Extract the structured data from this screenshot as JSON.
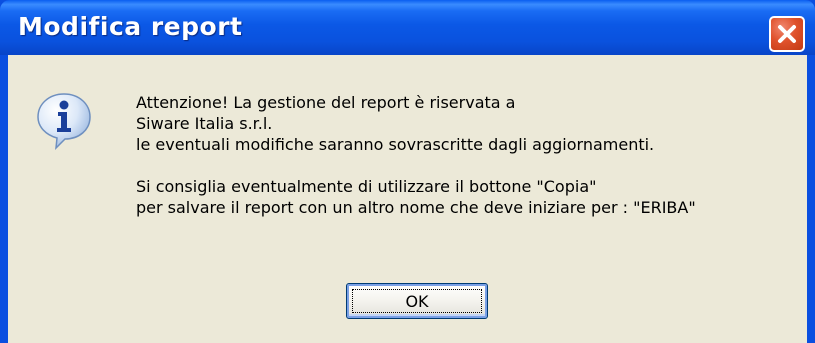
{
  "window": {
    "title": "Modifica report",
    "accent_color": "#0a52de",
    "close_icon": "close-icon"
  },
  "dialog": {
    "icon": "info-icon",
    "message_lines": [
      "Attenzione! La gestione del report è riservata a",
      "Siware Italia s.r.l.",
      "le eventuali modifiche saranno sovrascritte dagli aggiornamenti.",
      "",
      "Si consiglia eventualmente di utilizzare il bottone \"Copia\"",
      "per salvare il report con un altro nome che deve iniziare per : \"ERIBA\""
    ],
    "ok_label": "OK"
  }
}
